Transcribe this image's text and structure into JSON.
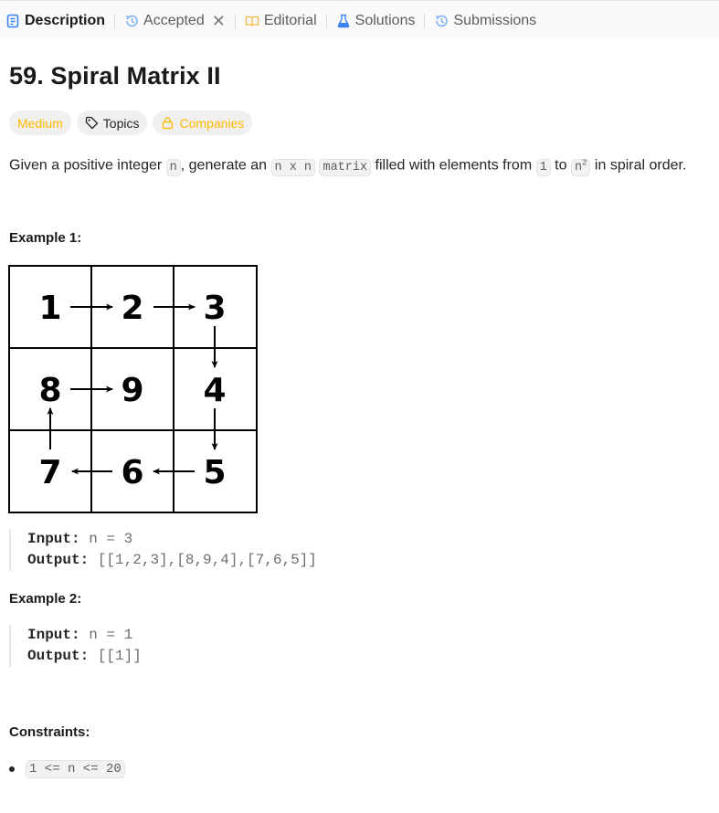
{
  "tabs": [
    {
      "label": "Description",
      "icon": "document-icon",
      "active": true
    },
    {
      "label": "Accepted",
      "icon": "history-icon",
      "active": false,
      "closable": true
    },
    {
      "label": "Editorial",
      "icon": "book-icon",
      "active": false
    },
    {
      "label": "Solutions",
      "icon": "flask-icon",
      "active": false
    },
    {
      "label": "Submissions",
      "icon": "history-icon",
      "active": false
    }
  ],
  "problem": {
    "title": "59. Spiral Matrix II",
    "difficulty": "Medium",
    "topics_label": "Topics",
    "companies_label": "Companies",
    "description": {
      "t1": "Given a positive integer ",
      "c1": "n",
      "t2": ", generate an ",
      "c2": "n x n",
      "t3": " ",
      "c3": "matrix",
      "t4": " filled with elements from ",
      "c4": "1",
      "t5": " to ",
      "c5_base": "n",
      "c5_sup": "2",
      "t6": " in spiral order."
    }
  },
  "examples": [
    {
      "heading": "Example 1:",
      "matrix": [
        [
          1,
          2,
          3
        ],
        [
          8,
          9,
          4
        ],
        [
          7,
          6,
          5
        ]
      ],
      "input_label": "Input:",
      "input_value": "n = 3",
      "output_label": "Output:",
      "output_value": "[[1,2,3],[8,9,4],[7,6,5]]"
    },
    {
      "heading": "Example 2:",
      "input_label": "Input:",
      "input_value": "n = 1",
      "output_label": "Output:",
      "output_value": "[[1]]"
    }
  ],
  "constraints": {
    "heading": "Constraints:",
    "items": [
      "1 <= n <= 20"
    ]
  },
  "colors": {
    "accent_blue": "#3b82f6",
    "difficulty_medium": "#ffb800",
    "text_dark": "#262626"
  }
}
